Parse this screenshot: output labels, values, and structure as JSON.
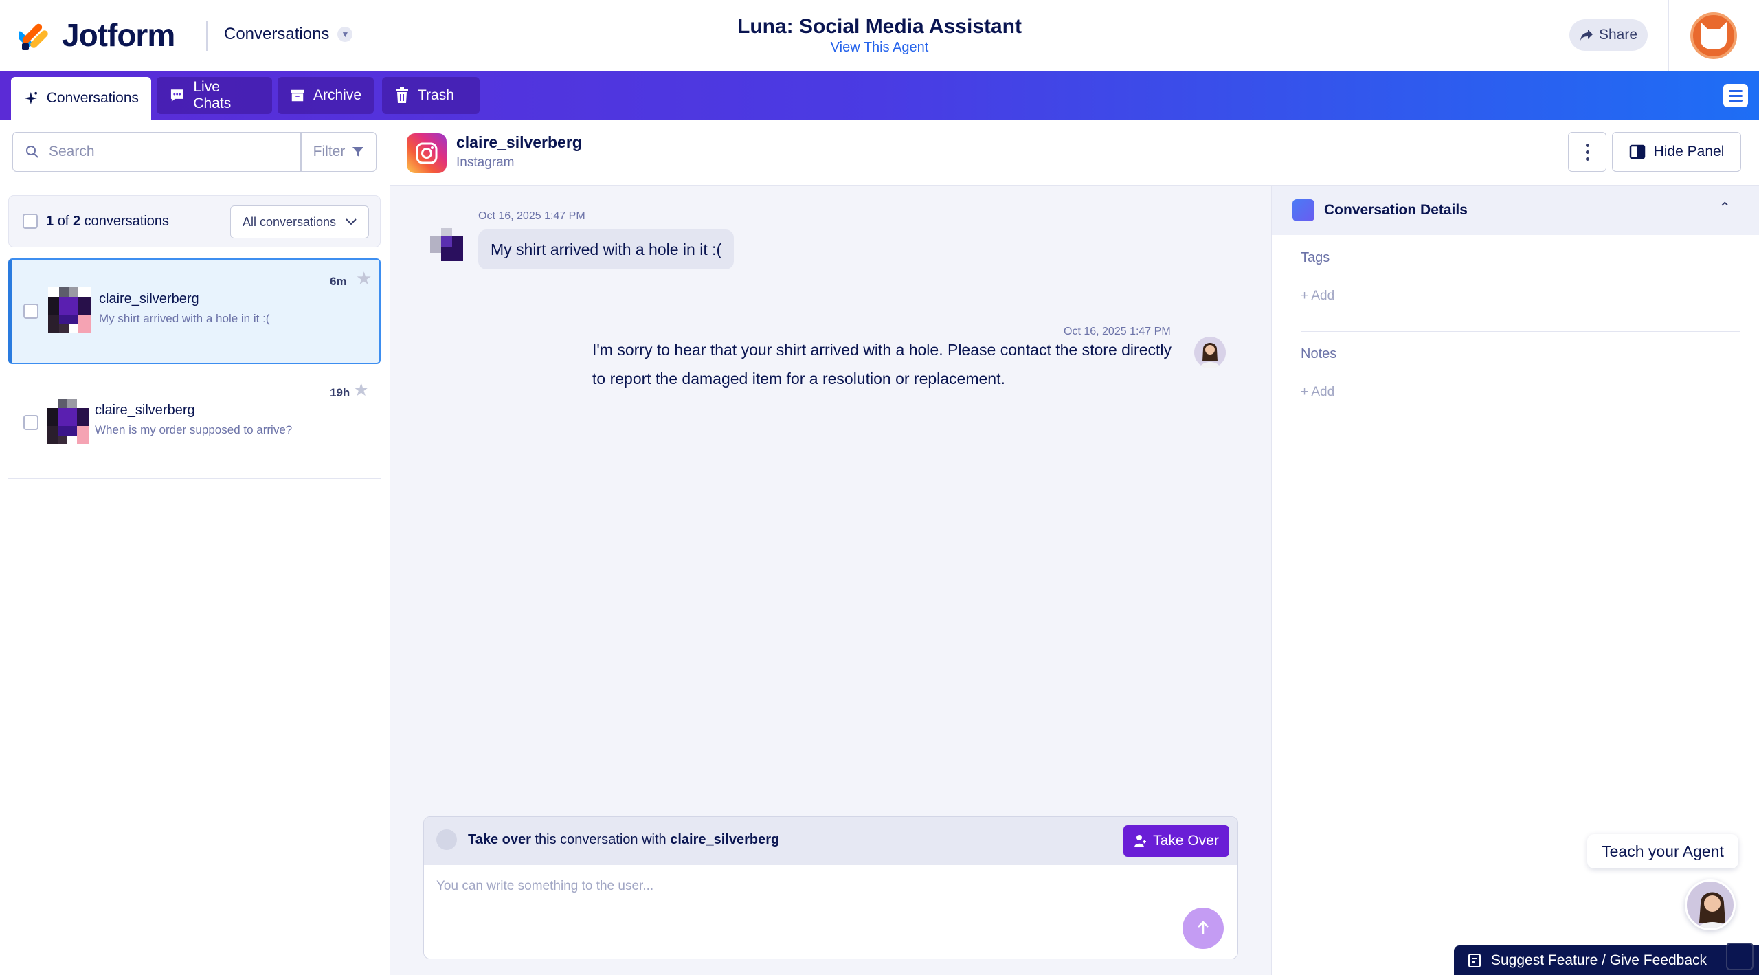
{
  "app": {
    "brand": "Jotform",
    "section_dropdown": "Conversations",
    "agent_title": "Luna: Social Media Assistant",
    "agent_link": "View This Agent",
    "share_label": "Share"
  },
  "tabs": [
    {
      "label": "Conversations",
      "icon": "sparkle-icon",
      "active": true
    },
    {
      "label": "Live Chats",
      "icon": "chat-icon",
      "active": false
    },
    {
      "label": "Archive",
      "icon": "archive-icon",
      "active": false
    },
    {
      "label": "Trash",
      "icon": "trash-icon",
      "active": false
    }
  ],
  "sidebar": {
    "search_placeholder": "Search",
    "filter_label": "Filter",
    "count_prefix": "1",
    "count_of": "of",
    "count_total": "2",
    "count_suffix": "conversations",
    "all_conversations_label": "All conversations",
    "conversations": [
      {
        "name": "claire_silverberg",
        "preview": "My shirt arrived with a hole in it :(",
        "time": "6m",
        "selected": true
      },
      {
        "name": "claire_silverberg",
        "preview": "When is my order supposed to arrive?",
        "time": "19h",
        "selected": false
      }
    ]
  },
  "chat": {
    "user_name": "claire_silverberg",
    "platform": "Instagram",
    "hide_panel_label": "Hide Panel",
    "messages": [
      {
        "from": "user",
        "time": "Oct 16, 2025 1:47 PM",
        "text": "My shirt arrived with a hole in it :("
      },
      {
        "from": "agent",
        "time": "Oct 16, 2025 1:47 PM",
        "text": "I'm sorry to hear that your shirt arrived with a hole. Please contact the store directly to report the damaged item for a resolution or replacement."
      }
    ],
    "takeover_bold": "Take over",
    "takeover_middle": "this conversation with",
    "takeover_user": "claire_silverberg",
    "takeover_button": "Take Over",
    "input_placeholder": "You can write something to the user..."
  },
  "details": {
    "title": "Conversation Details",
    "tags_label": "Tags",
    "tags_add": "+ Add",
    "notes_label": "Notes",
    "notes_add": "+ Add"
  },
  "footer": {
    "teach_label": "Teach your Agent",
    "feedback_label": "Suggest Feature / Give Feedback"
  },
  "colors": {
    "brand_navy": "#0a1551",
    "tab_gradient_start": "#5b2bd6",
    "tab_gradient_end": "#1e6ef5",
    "takeover_purple": "#6a1ed6",
    "selected_blue": "#2a7bdf",
    "link_blue": "#2563eb"
  }
}
